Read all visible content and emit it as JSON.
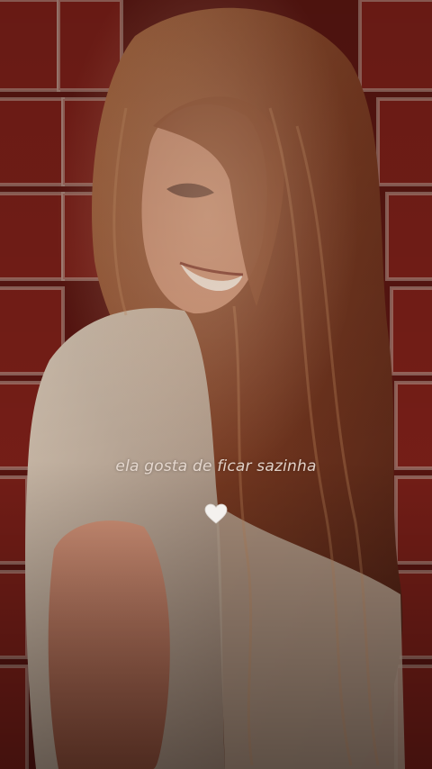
{
  "caption": {
    "text": "ela gosta de ficar sazinha"
  },
  "icons": {
    "heart": "white-heart-icon"
  },
  "colors": {
    "brick": "#7a1f18",
    "mortar": "#b59a8e",
    "hair": "#8a4a2a",
    "shirt": "#c9b8a6",
    "skin": "#b8735a",
    "heart": "#f4f1ee"
  }
}
